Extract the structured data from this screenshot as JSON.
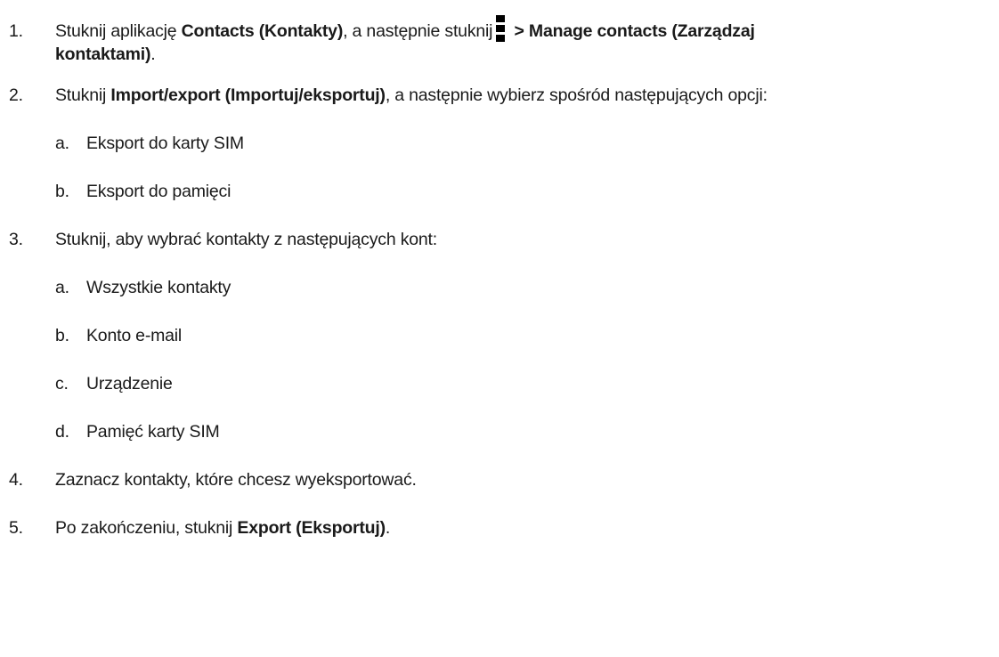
{
  "steps": [
    {
      "number": "1.",
      "text_a": "Stuknij aplikację ",
      "bold_a": "Contacts (Kontakty)",
      "text_b": ", a następnie stuknij",
      "icon": "overflow-menu-icon",
      "bold_b": " > Manage contacts (Zarządzaj",
      "bold_c": "kontaktami)",
      "text_c": "."
    },
    {
      "number": "2.",
      "text_a": "Stuknij ",
      "bold_a": "Import/export (Importuj/eksportuj)",
      "text_b": ", a następnie wybierz spośród następujących opcji:",
      "options": [
        {
          "letter": "a.",
          "label": "Eksport do karty SIM"
        },
        {
          "letter": "b.",
          "label": "Eksport do pamięci"
        }
      ]
    },
    {
      "number": "3.",
      "text_a": "Stuknij, aby wybrać kontakty z następujących kont:",
      "options": [
        {
          "letter": "a.",
          "label": "Wszystkie kontakty"
        },
        {
          "letter": "b.",
          "label": "Konto e-mail"
        },
        {
          "letter": "c.",
          "label": "Urządzenie"
        },
        {
          "letter": "d.",
          "label": "Pamięć karty SIM"
        }
      ]
    },
    {
      "number": "4.",
      "text_a": "Zaznacz kontakty, które chcesz wyeksportować."
    },
    {
      "number": "5.",
      "text_a": "Po zakończeniu, stuknij ",
      "bold_a": "Export (Eksportuj)",
      "text_b": "."
    }
  ]
}
